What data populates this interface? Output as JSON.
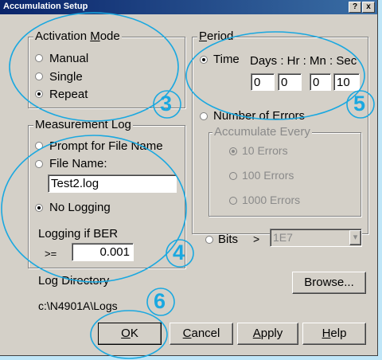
{
  "window": {
    "title": "Accumulation Setup",
    "help_btn": "?",
    "close_btn": "x"
  },
  "activation": {
    "label_pre": "Activation ",
    "label_key": "M",
    "label_post": "ode",
    "options": [
      "Manual",
      "Single",
      "Repeat"
    ]
  },
  "log": {
    "label": "Measurement Log",
    "prompt": "Prompt for File Name",
    "file_name_label": "File Name:",
    "file_name_value": "Test2.log",
    "no_logging": "No Logging",
    "ber_label": "Logging if BER",
    "ber_op": ">=",
    "ber_value": "0.001"
  },
  "period": {
    "label_key": "P",
    "label_post": "eriod",
    "time": "Time",
    "time_header": "Days : Hr : Mn : Sec",
    "days": "0",
    "hr": "0",
    "mn": "0",
    "sec": "10",
    "errors": "Number of Errors",
    "accumulate_label": "Accumulate Every",
    "acc_options": [
      "10 Errors",
      "100 Errors",
      "1000 Errors"
    ],
    "bits": "Bits",
    "bits_op": ">",
    "bits_value": "1E7",
    "dropdown_glyph": "▾"
  },
  "log_directory": {
    "label": "Log Directory",
    "path": "c:\\N4901A\\Logs"
  },
  "buttons": {
    "browse": "Browse...",
    "ok_key": "O",
    "ok_rest": "K",
    "cancel_key": "C",
    "cancel_rest": "ancel",
    "apply_key": "A",
    "apply_rest": "pply",
    "help_key": "H",
    "help_rest": "elp"
  },
  "callouts": [
    "3",
    "4",
    "5",
    "6"
  ],
  "colors": {
    "callout": "#1aa8e0",
    "titlebar": "#0a246a",
    "background": "#bfe6f8"
  }
}
